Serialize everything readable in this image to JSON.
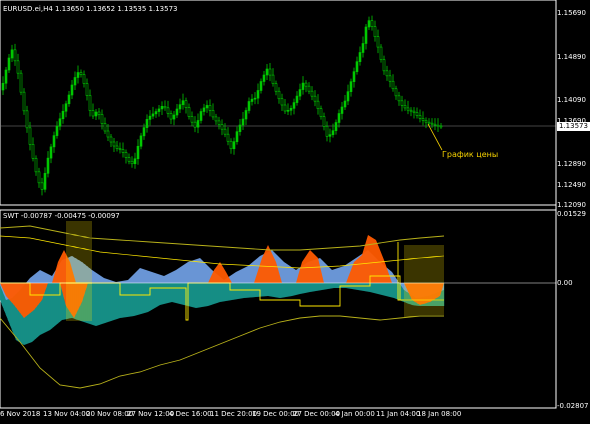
{
  "price_panel": {
    "header": "EURUSD.ei,H4  1.13650 1.13652 1.13535 1.13573",
    "current_price": "1.13573",
    "annotation": "График цены",
    "y_labels": [
      "1.15690",
      "1.14890",
      "1.14090",
      "1.13690",
      "1.12890",
      "1.12490",
      "1.12090"
    ],
    "candle_color": "#00c800"
  },
  "indicator_panel": {
    "header": "SWT -0.00787 -0.00475 -0.00097",
    "y_labels": [
      "0.01529",
      "0.00",
      "-0.02807"
    ],
    "colors": {
      "teal": "#1aa39a",
      "blue": "#6f9de0",
      "orange": "#ff5a00",
      "yellow": "#ffe800",
      "olive": "#b9b21a"
    }
  },
  "time_axis": [
    "6 Nov 2018",
    "13 Nov 04:00",
    "20 Nov 08:00",
    "27 Nov 12:00",
    "4 Dec 16:00",
    "11 Dec 20:00",
    "19 Dec 00:00",
    "27 Dec 00:00",
    "4 Jan 00:00",
    "11 Jan 04:00",
    "18 Jan 08:00"
  ]
}
